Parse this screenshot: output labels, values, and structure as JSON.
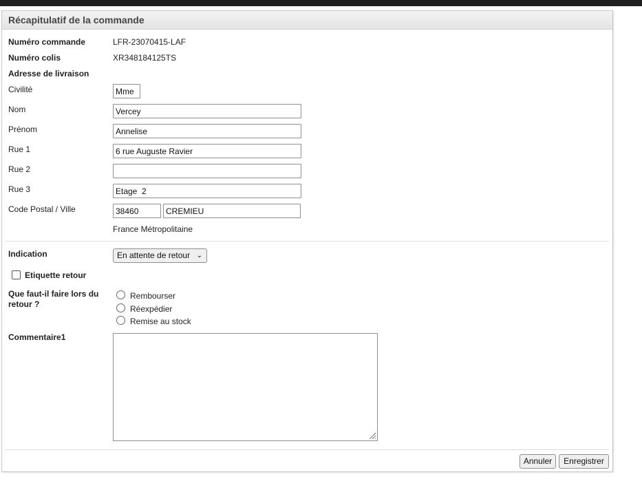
{
  "header": {
    "title": "Récapitulatif de la commande"
  },
  "order": {
    "number_label": "Numéro commande",
    "number_value": "LFR-23070415-LAF",
    "parcel_label": "Numéro colis",
    "parcel_value": "XR348184125TS",
    "address_heading": "Adresse de livraison"
  },
  "address": {
    "civility_label": "Civilité",
    "civility_value": "Mme",
    "lastname_label": "Nom",
    "lastname_value": "Vercey",
    "firstname_label": "Prénom",
    "firstname_value": "Annelise",
    "street1_label": "Rue 1",
    "street1_value": "6 rue Auguste Ravier",
    "street2_label": "Rue 2",
    "street2_value": "",
    "street3_label": "Rue 3",
    "street3_value": "Etage  2",
    "postal_city_label": "Code Postal / Ville",
    "postal_value": "38460",
    "city_value": "CREMIEU",
    "country": "France Métropolitaine"
  },
  "indication": {
    "label": "Indication",
    "selected": "En attente de retour"
  },
  "return_label": {
    "label": "Etiquette retour",
    "checked": false
  },
  "return_action": {
    "question": "Que faut-il faire lors du retour ?",
    "question_line1": "Que faut-il faire lors du",
    "question_line2": "retour ?",
    "options": [
      "Rembourser",
      "Réexpédier",
      "Remise au stock"
    ],
    "selected_index": -1
  },
  "comment": {
    "label": "Commentaire1",
    "value": ""
  },
  "actions": {
    "cancel_label": "Annuler",
    "save_label": "Enregistrer"
  }
}
